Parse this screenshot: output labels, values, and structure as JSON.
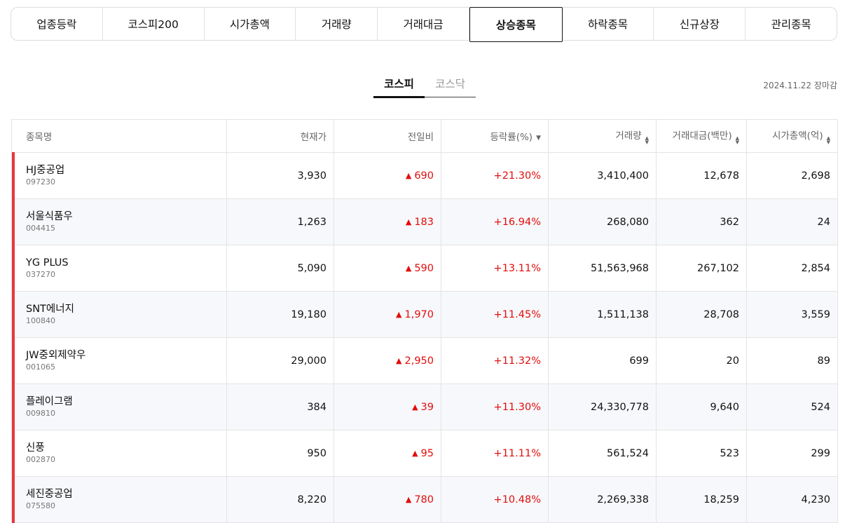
{
  "tabs": [
    "업종등락",
    "코스피200",
    "시가총액",
    "거래량",
    "거래대금",
    "상승종목",
    "하락종목",
    "신규상장",
    "관리종목"
  ],
  "active_tab": "상승종목",
  "market_tabs": [
    "코스피",
    "코스닥"
  ],
  "active_market": "코스피",
  "updated": "2024.11.22 장마감",
  "columns": [
    "종목명",
    "현재가",
    "전일비",
    "등락률(%)",
    "거래량",
    "거래대금(백만)",
    "시가총액(억)"
  ],
  "rows": [
    {
      "name": "HJ중공업",
      "code": "097230",
      "price": "3,930",
      "change": "690",
      "rate": "+21.30%",
      "volume": "3,410,400",
      "amount": "12,678",
      "cap": "2,698"
    },
    {
      "name": "서울식품우",
      "code": "004415",
      "price": "1,263",
      "change": "183",
      "rate": "+16.94%",
      "volume": "268,080",
      "amount": "362",
      "cap": "24"
    },
    {
      "name": "YG PLUS",
      "code": "037270",
      "price": "5,090",
      "change": "590",
      "rate": "+13.11%",
      "volume": "51,563,968",
      "amount": "267,102",
      "cap": "2,854"
    },
    {
      "name": "SNT에너지",
      "code": "100840",
      "price": "19,180",
      "change": "1,970",
      "rate": "+11.45%",
      "volume": "1,511,138",
      "amount": "28,708",
      "cap": "3,559"
    },
    {
      "name": "JW중외제약우",
      "code": "001065",
      "price": "29,000",
      "change": "2,950",
      "rate": "+11.32%",
      "volume": "699",
      "amount": "20",
      "cap": "89"
    },
    {
      "name": "플레이그램",
      "code": "009810",
      "price": "384",
      "change": "39",
      "rate": "+11.30%",
      "volume": "24,330,778",
      "amount": "9,640",
      "cap": "524"
    },
    {
      "name": "신풍",
      "code": "002870",
      "price": "950",
      "change": "95",
      "rate": "+11.11%",
      "volume": "561,524",
      "amount": "523",
      "cap": "299"
    },
    {
      "name": "세진중공업",
      "code": "075580",
      "price": "8,220",
      "change": "780",
      "rate": "+10.48%",
      "volume": "2,269,338",
      "amount": "18,259",
      "cap": "4,230"
    }
  ],
  "colors": {
    "up": "#e20d0d",
    "row_marker": "#e8373d"
  }
}
